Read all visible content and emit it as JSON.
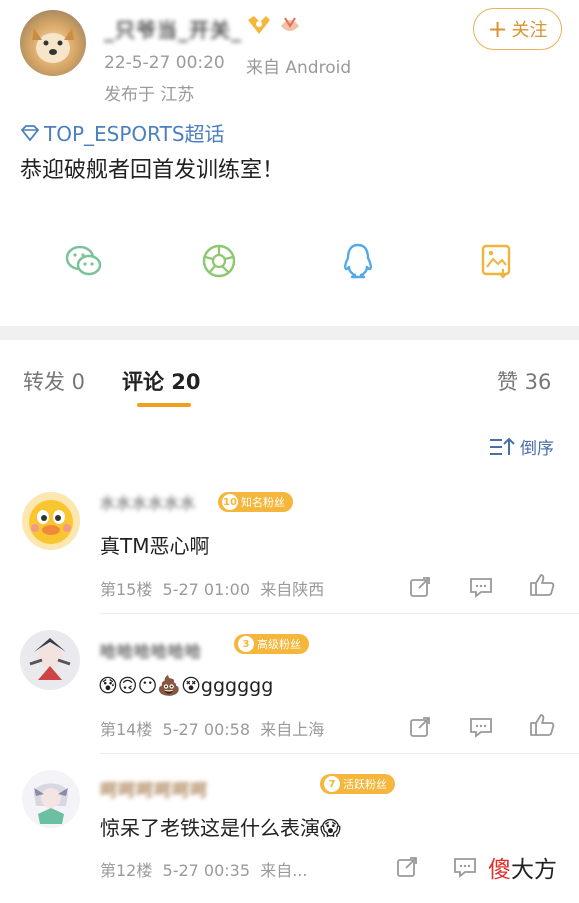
{
  "post": {
    "username": "_只爷当_开关_",
    "time": "22-5-27 00:20",
    "source": "来自 Android",
    "location": "发布于 江苏",
    "follow_label": "关注",
    "topic": "TOP_ESPORTS超话",
    "text": "恭迎破舰者回首发训练室！"
  },
  "tabs": {
    "repost": "转发 0",
    "comment": "评论 20",
    "like": "赞 36"
  },
  "sort_label": "倒序",
  "comments": [
    {
      "username": "水水水水水水",
      "badge_level": "10",
      "badge_text": "知名粉丝",
      "badge_color": "#f5b63c",
      "text": "真TM恶心啊",
      "meta": "第15楼  5-27 01:00  来自陕西"
    },
    {
      "username": "哈哈哈哈哈哈",
      "badge_level": "3",
      "badge_text": "高级粉丝",
      "badge_color": "#f5b63c",
      "text": "😰🙃😶💩😵gggggg",
      "meta": "第14楼  5-27 00:58  来自上海"
    },
    {
      "username": "呵呵呵呵呵呵",
      "badge_level": "7",
      "badge_text": "活跃粉丝",
      "badge_color": "#f5b63c",
      "text": "惊呆了老铁这是什么表演😱",
      "meta": "第12楼  5-27 00:35  来自..."
    }
  ],
  "watermark": {
    "char1": "傻",
    "rest": "大方"
  },
  "colors": {
    "accent": "#f0a020",
    "wechat": "#7ac39a",
    "moments": "#8cc86f",
    "qq": "#52a8e8",
    "save": "#f0b43c"
  }
}
